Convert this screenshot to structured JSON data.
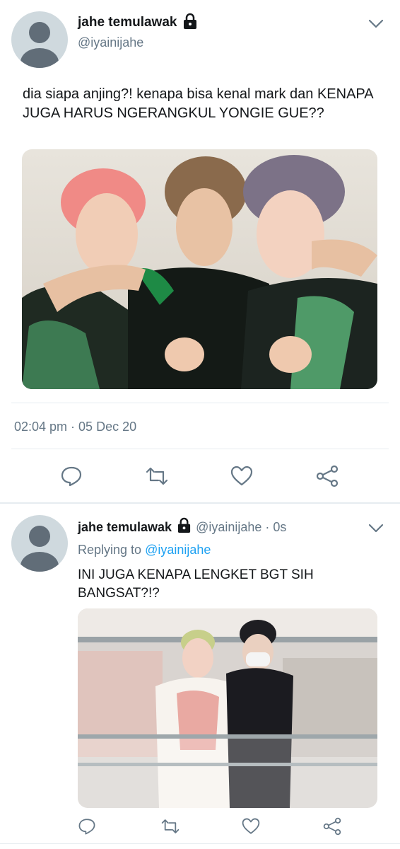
{
  "tweet1": {
    "display_name": "jahe temulawak",
    "handle": "@iyainijahe",
    "text": "dia siapa anjing?! kenapa bisa kenal mark dan KENAPA JUGA HARUS NGERANGKUL YONGIE GUE??",
    "timestamp": "02:04 pm · 05 Dec 20",
    "image_alt": "photo-three-people-selfie",
    "icons": [
      "reply-icon",
      "retweet-icon",
      "like-icon",
      "share-icon"
    ]
  },
  "tweet2": {
    "display_name": "jahe temulawak",
    "handle": "@iyainijahe",
    "time": "· 0s",
    "replying_prefix": "Replying to",
    "replying_handle": "@iyainijahe",
    "text": "INI JUGA KENAPA LENGKET BGT SIH BANGSAT?!?",
    "image_alt": "photo-two-people-at-railing",
    "icons": [
      "reply-icon",
      "retweet-icon",
      "like-icon",
      "share-icon"
    ]
  },
  "colors": {
    "text": "#14171a",
    "muted": "#657786",
    "link": "#1da1f2",
    "separator": "#e6ecf0",
    "avatar_bg": "#cfd9de",
    "avatar_fg": "#616d78"
  }
}
